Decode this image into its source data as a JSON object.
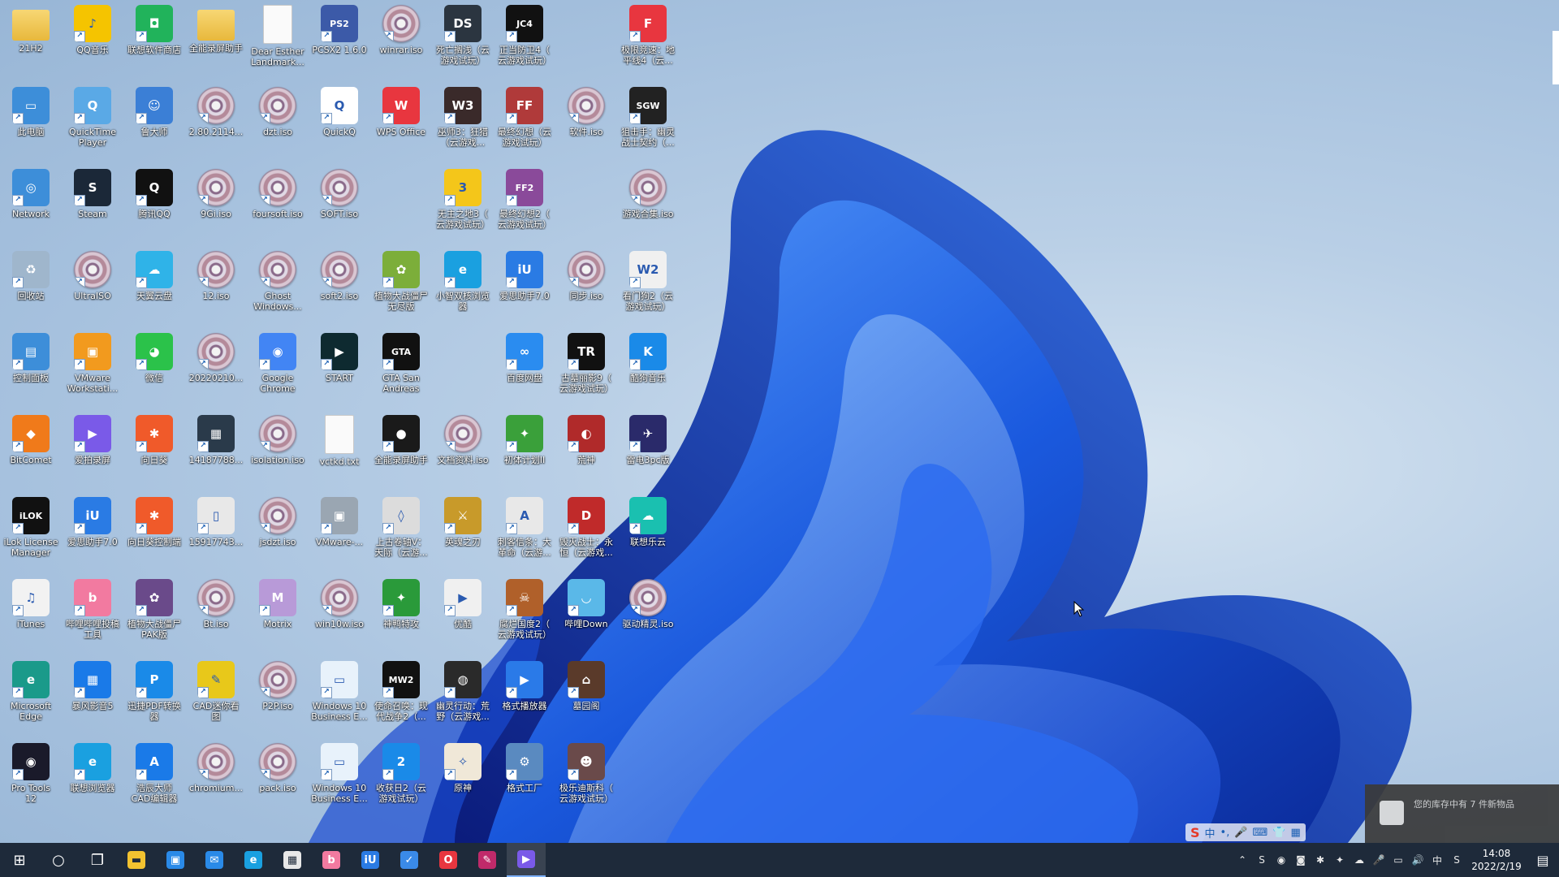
{
  "desktop": {
    "icons": [
      {
        "label": "21H2",
        "kind": "folder",
        "color": "#e9b94a",
        "glyph": "",
        "col": 0,
        "row": 0
      },
      {
        "label": "QQ音乐",
        "kind": "app",
        "color": "#f5c400",
        "glyph": "♪",
        "col": 1,
        "row": 0
      },
      {
        "label": "联想软件商店",
        "kind": "app",
        "color": "#21b35b",
        "glyph": "◘",
        "col": 2,
        "row": 0
      },
      {
        "label": "全能录屏助手",
        "kind": "folder",
        "color": "#e9b94a",
        "glyph": "",
        "col": 3,
        "row": 0
      },
      {
        "label": "Dear Esther\nLandmark...",
        "kind": "file",
        "color": "#fafafa",
        "glyph": "",
        "col": 4,
        "row": 0
      },
      {
        "label": "PCSX2 1.6.0",
        "kind": "app",
        "color": "#3c5aa8",
        "glyph": "PS2",
        "col": 5,
        "row": 0
      },
      {
        "label": "winrar.iso",
        "kind": "disc",
        "color": "",
        "glyph": "",
        "col": 6,
        "row": 0
      },
      {
        "label": "死亡搁浅（云\n游戏试玩）",
        "kind": "app",
        "color": "#2b3540",
        "glyph": "DS",
        "col": 7,
        "row": 0
      },
      {
        "label": "正当防卫4（\n云游戏试玩）",
        "kind": "app",
        "color": "#111111",
        "glyph": "JC4",
        "col": 8,
        "row": 0
      },
      {
        "label": "极限竞速：地\n平线4（云...",
        "kind": "app",
        "color": "#e8363f",
        "glyph": "F",
        "col": 10,
        "row": 0
      },
      {
        "label": "此电脑",
        "kind": "app",
        "color": "#3d8ed9",
        "glyph": "▭",
        "col": 0,
        "row": 1
      },
      {
        "label": "QuickTime\nPlayer",
        "kind": "app",
        "color": "#5aa9e6",
        "glyph": "Q",
        "col": 1,
        "row": 1
      },
      {
        "label": "鲁大师",
        "kind": "app",
        "color": "#3b7fd6",
        "glyph": "☺",
        "col": 2,
        "row": 1
      },
      {
        "label": "2.80.2114...",
        "kind": "disc",
        "color": "",
        "glyph": "",
        "col": 3,
        "row": 1
      },
      {
        "label": "dzt.iso",
        "kind": "disc",
        "color": "",
        "glyph": "",
        "col": 4,
        "row": 1
      },
      {
        "label": "QuickQ",
        "kind": "app",
        "color": "#ffffff",
        "glyph": "Q",
        "col": 5,
        "row": 1
      },
      {
        "label": "WPS Office",
        "kind": "app",
        "color": "#e8363f",
        "glyph": "W",
        "col": 6,
        "row": 1
      },
      {
        "label": "巫师3：狂猎\n（云游戏...",
        "kind": "app",
        "color": "#3a2a2a",
        "glyph": "W3",
        "col": 7,
        "row": 1
      },
      {
        "label": "最终幻想（云\n游戏试玩）",
        "kind": "app",
        "color": "#b03a3a",
        "glyph": "FF",
        "col": 8,
        "row": 1
      },
      {
        "label": "软件.iso",
        "kind": "disc",
        "color": "",
        "glyph": "",
        "col": 9,
        "row": 1
      },
      {
        "label": "狙击手：幽灵\n战士契约（...",
        "kind": "app",
        "color": "#222222",
        "glyph": "SGW",
        "col": 10,
        "row": 1
      },
      {
        "label": "Network",
        "kind": "app",
        "color": "#3d8ed9",
        "glyph": "◎",
        "col": 0,
        "row": 2
      },
      {
        "label": "Steam",
        "kind": "app",
        "color": "#1b2838",
        "glyph": "S",
        "col": 1,
        "row": 2
      },
      {
        "label": "腾讯QQ",
        "kind": "app",
        "color": "#111111",
        "glyph": "Q",
        "col": 2,
        "row": 2
      },
      {
        "label": "9Gi.iso",
        "kind": "disc",
        "color": "",
        "glyph": "",
        "col": 3,
        "row": 2
      },
      {
        "label": "foursoft.iso",
        "kind": "disc",
        "color": "",
        "glyph": "",
        "col": 4,
        "row": 2
      },
      {
        "label": "SOFT.iso",
        "kind": "disc",
        "color": "",
        "glyph": "",
        "col": 5,
        "row": 2
      },
      {
        "label": "无主之地3（\n云游戏试玩）",
        "kind": "app",
        "color": "#f4c61a",
        "glyph": "3",
        "col": 7,
        "row": 2
      },
      {
        "label": "最终幻想2（\n云游戏试玩）",
        "kind": "app",
        "color": "#8a4a9a",
        "glyph": "FF2",
        "col": 8,
        "row": 2
      },
      {
        "label": "游戏合集.iso",
        "kind": "disc",
        "color": "",
        "glyph": "",
        "col": 10,
        "row": 2
      },
      {
        "label": "回收站",
        "kind": "app",
        "color": "#9fb6cc",
        "glyph": "♻",
        "col": 0,
        "row": 3
      },
      {
        "label": "UltraISO",
        "kind": "disc",
        "color": "",
        "glyph": "",
        "col": 1,
        "row": 3
      },
      {
        "label": "天翼云盘",
        "kind": "app",
        "color": "#2fb3e8",
        "glyph": "☁",
        "col": 2,
        "row": 3
      },
      {
        "label": "12.iso",
        "kind": "disc",
        "color": "",
        "glyph": "",
        "col": 3,
        "row": 3
      },
      {
        "label": "Ghost\nWindows...",
        "kind": "disc",
        "color": "",
        "glyph": "",
        "col": 4,
        "row": 3
      },
      {
        "label": "soft2.iso",
        "kind": "disc",
        "color": "",
        "glyph": "",
        "col": 5,
        "row": 3
      },
      {
        "label": "植物大战僵尸\n无尽版",
        "kind": "app",
        "color": "#7cae3a",
        "glyph": "✿",
        "col": 6,
        "row": 3
      },
      {
        "label": "小智双核浏览\n器",
        "kind": "app",
        "color": "#1aa0e0",
        "glyph": "e",
        "col": 7,
        "row": 3
      },
      {
        "label": "爱思助手7.0",
        "kind": "app",
        "color": "#2a7be4",
        "glyph": "iU",
        "col": 8,
        "row": 3
      },
      {
        "label": "同步.iso",
        "kind": "disc",
        "color": "",
        "glyph": "",
        "col": 9,
        "row": 3
      },
      {
        "label": "看门狗2（云\n游戏试玩）",
        "kind": "app",
        "color": "#f0f0f0",
        "glyph": "W2",
        "col": 10,
        "row": 3
      },
      {
        "label": "控制面板",
        "kind": "app",
        "color": "#3d8ed9",
        "glyph": "▤",
        "col": 0,
        "row": 4
      },
      {
        "label": "VMware\nWorkstati...",
        "kind": "app",
        "color": "#f29a1e",
        "glyph": "▣",
        "col": 1,
        "row": 4
      },
      {
        "label": "微信",
        "kind": "app",
        "color": "#2bc24a",
        "glyph": "◕",
        "col": 2,
        "row": 4
      },
      {
        "label": "20220210...",
        "kind": "disc",
        "color": "",
        "glyph": "",
        "col": 3,
        "row": 4
      },
      {
        "label": "Google\nChrome",
        "kind": "app",
        "color": "#4285f4",
        "glyph": "◉",
        "col": 4,
        "row": 4
      },
      {
        "label": "START",
        "kind": "app",
        "color": "#0e2a30",
        "glyph": "▶",
        "col": 5,
        "row": 4
      },
      {
        "label": "GTA San\nAndreas",
        "kind": "app",
        "color": "#111111",
        "glyph": "GTA",
        "col": 6,
        "row": 4
      },
      {
        "label": "百度网盘",
        "kind": "app",
        "color": "#2a8cf0",
        "glyph": "∞",
        "col": 8,
        "row": 4
      },
      {
        "label": "古墓丽影9（\n云游戏试玩）",
        "kind": "app",
        "color": "#111111",
        "glyph": "TR",
        "col": 9,
        "row": 4
      },
      {
        "label": "酷狗音乐",
        "kind": "app",
        "color": "#1a8ae8",
        "glyph": "K",
        "col": 10,
        "row": 4
      },
      {
        "label": "BitComet",
        "kind": "app",
        "color": "#f07a1a",
        "glyph": "◆",
        "col": 0,
        "row": 5
      },
      {
        "label": "爱拍录屏",
        "kind": "app",
        "color": "#7a5ae8",
        "glyph": "▶",
        "col": 1,
        "row": 5
      },
      {
        "label": "向日葵",
        "kind": "app",
        "color": "#f05a2a",
        "glyph": "✱",
        "col": 2,
        "row": 5
      },
      {
        "label": "14187788...",
        "kind": "app",
        "color": "#2a3a4a",
        "glyph": "▦",
        "col": 3,
        "row": 5
      },
      {
        "label": "isolation.iso",
        "kind": "disc",
        "color": "",
        "glyph": "",
        "col": 4,
        "row": 5
      },
      {
        "label": "vctkd.txt",
        "kind": "file",
        "color": "#fafafa",
        "glyph": "",
        "col": 5,
        "row": 5
      },
      {
        "label": "全能录屏助手",
        "kind": "app",
        "color": "#1a1a1a",
        "glyph": "●",
        "col": 6,
        "row": 5
      },
      {
        "label": "文档资料.iso",
        "kind": "disc",
        "color": "",
        "glyph": "",
        "col": 7,
        "row": 5
      },
      {
        "label": "初体计划II",
        "kind": "app",
        "color": "#3aa03a",
        "glyph": "✦",
        "col": 8,
        "row": 5
      },
      {
        "label": "荒神",
        "kind": "app",
        "color": "#b02a2a",
        "glyph": "◐",
        "col": 9,
        "row": 5
      },
      {
        "label": "雷电3pc版",
        "kind": "app",
        "color": "#2a2a6a",
        "glyph": "✈",
        "col": 10,
        "row": 5
      },
      {
        "label": "iLok License\nManager",
        "kind": "app",
        "color": "#111111",
        "glyph": "iLOK",
        "col": 0,
        "row": 6
      },
      {
        "label": "爱思助手7.0",
        "kind": "app",
        "color": "#2a7be4",
        "glyph": "iU",
        "col": 1,
        "row": 6
      },
      {
        "label": "向日葵控制端",
        "kind": "app",
        "color": "#f05a2a",
        "glyph": "✱",
        "col": 2,
        "row": 6
      },
      {
        "label": "15917743...",
        "kind": "app",
        "color": "#e8e8e8",
        "glyph": "▯",
        "col": 3,
        "row": 6
      },
      {
        "label": "jsdzt.iso",
        "kind": "disc",
        "color": "",
        "glyph": "",
        "col": 4,
        "row": 6
      },
      {
        "label": "VMware-...",
        "kind": "app",
        "color": "#9aa6b2",
        "glyph": "▣",
        "col": 5,
        "row": 6
      },
      {
        "label": "上古卷轴V：\n天际（云游...",
        "kind": "app",
        "color": "#dcdcdc",
        "glyph": "◊",
        "col": 6,
        "row": 6
      },
      {
        "label": "英魂之刃",
        "kind": "app",
        "color": "#c89a2a",
        "glyph": "⚔",
        "col": 7,
        "row": 6
      },
      {
        "label": "刺客信条：大\n革命（云游...",
        "kind": "app",
        "color": "#e8e8e8",
        "glyph": "A",
        "col": 8,
        "row": 6
      },
      {
        "label": "毁灭战士：永\n恒（云游戏...",
        "kind": "app",
        "color": "#c02a2a",
        "glyph": "D",
        "col": 9,
        "row": 6
      },
      {
        "label": "联想乐云",
        "kind": "app",
        "color": "#1ac0b0",
        "glyph": "☁",
        "col": 10,
        "row": 6
      },
      {
        "label": "iTunes",
        "kind": "app",
        "color": "#f2f2f2",
        "glyph": "♫",
        "col": 0,
        "row": 7
      },
      {
        "label": "哔哩哔哩投稿\n工具",
        "kind": "app",
        "color": "#f27aa0",
        "glyph": "b",
        "col": 1,
        "row": 7
      },
      {
        "label": "植物大战僵尸\nPAK版",
        "kind": "app",
        "color": "#6a4a8a",
        "glyph": "✿",
        "col": 2,
        "row": 7
      },
      {
        "label": "Bt.iso",
        "kind": "disc",
        "color": "",
        "glyph": "",
        "col": 3,
        "row": 7
      },
      {
        "label": "Motrix",
        "kind": "app",
        "color": "#b89ad8",
        "glyph": "M",
        "col": 4,
        "row": 7
      },
      {
        "label": "win10w.iso",
        "kind": "disc",
        "color": "",
        "glyph": "",
        "col": 5,
        "row": 7
      },
      {
        "label": "神鸭特攻",
        "kind": "app",
        "color": "#2a9a3a",
        "glyph": "✦",
        "col": 6,
        "row": 7
      },
      {
        "label": "优酷",
        "kind": "app",
        "color": "#f0f0f0",
        "glyph": "▶",
        "col": 7,
        "row": 7
      },
      {
        "label": "腐烂国度2（\n云游戏试玩）",
        "kind": "app",
        "color": "#b0602a",
        "glyph": "☠",
        "col": 8,
        "row": 7
      },
      {
        "label": "哔哩Down",
        "kind": "app",
        "color": "#5ab8e8",
        "glyph": "◡",
        "col": 9,
        "row": 7
      },
      {
        "label": "驱动精灵.iso",
        "kind": "disc",
        "color": "",
        "glyph": "",
        "col": 10,
        "row": 7
      },
      {
        "label": "Microsoft\nEdge",
        "kind": "app",
        "color": "#1a9a8a",
        "glyph": "e",
        "col": 0,
        "row": 8
      },
      {
        "label": "暴风影音5",
        "kind": "app",
        "color": "#1a7ae8",
        "glyph": "▦",
        "col": 1,
        "row": 8
      },
      {
        "label": "迅捷PDF转换\n器",
        "kind": "app",
        "color": "#1a8ae8",
        "glyph": "P",
        "col": 2,
        "row": 8
      },
      {
        "label": "CAD迷你看\n图",
        "kind": "app",
        "color": "#e8c81a",
        "glyph": "✎",
        "col": 3,
        "row": 8
      },
      {
        "label": "P2P.iso",
        "kind": "disc",
        "color": "",
        "glyph": "",
        "col": 4,
        "row": 8
      },
      {
        "label": "Windows 10\nBusiness E...",
        "kind": "app",
        "color": "#e8f2fb",
        "glyph": "▭",
        "col": 5,
        "row": 8
      },
      {
        "label": "使命召唤：现\n代战争2（...",
        "kind": "app",
        "color": "#111111",
        "glyph": "MW2",
        "col": 6,
        "row": 8
      },
      {
        "label": "幽灵行动：荒\n野（云游戏...",
        "kind": "app",
        "color": "#2a2a2a",
        "glyph": "◍",
        "col": 7,
        "row": 8
      },
      {
        "label": "格式播放器",
        "kind": "app",
        "color": "#2a7ae8",
        "glyph": "▶",
        "col": 8,
        "row": 8
      },
      {
        "label": "墓园阁",
        "kind": "app",
        "color": "#5a3a2a",
        "glyph": "⌂",
        "col": 9,
        "row": 8
      },
      {
        "label": "Pro Tools\n12",
        "kind": "app",
        "color": "#1a1a2a",
        "glyph": "◉",
        "col": 0,
        "row": 9
      },
      {
        "label": "联想浏览器",
        "kind": "app",
        "color": "#1aa0e0",
        "glyph": "e",
        "col": 1,
        "row": 9
      },
      {
        "label": "浩辰大师\nCAD编辑器",
        "kind": "app",
        "color": "#1a7ae8",
        "glyph": "A",
        "col": 2,
        "row": 9
      },
      {
        "label": "chromium...",
        "kind": "disc",
        "color": "",
        "glyph": "",
        "col": 3,
        "row": 9
      },
      {
        "label": "pack.iso",
        "kind": "disc",
        "color": "",
        "glyph": "",
        "col": 4,
        "row": 9
      },
      {
        "label": "Windows 10\nBusiness E...",
        "kind": "app",
        "color": "#e8f2fb",
        "glyph": "▭",
        "col": 5,
        "row": 9
      },
      {
        "label": "收获日2（云\n游戏试玩）",
        "kind": "app",
        "color": "#1a8ae8",
        "glyph": "2",
        "col": 6,
        "row": 9
      },
      {
        "label": "原神",
        "kind": "app",
        "color": "#f0e8d8",
        "glyph": "✧",
        "col": 7,
        "row": 9
      },
      {
        "label": "格式工厂",
        "kind": "app",
        "color": "#5a8ac0",
        "glyph": "⚙",
        "col": 8,
        "row": 9
      },
      {
        "label": "极乐迪斯科（\n云游戏试玩）",
        "kind": "app",
        "color": "#6a4a4a",
        "glyph": "☻",
        "col": 9,
        "row": 9
      }
    ]
  },
  "notification": {
    "text": "您的库存中有 7 件新物品"
  },
  "ime": {
    "brand": "S",
    "items": [
      "中",
      "•,",
      "🎤",
      "⌨",
      "👕",
      "▦"
    ]
  },
  "taskbar": {
    "items": [
      {
        "name": "start-button",
        "glyph": "⊞",
        "color": "#ffffff"
      },
      {
        "name": "search-button",
        "glyph": "○",
        "color": "#ffffff"
      },
      {
        "name": "task-view-button",
        "glyph": "❐",
        "color": "#ffffff"
      },
      {
        "name": "taskbar-file-explorer",
        "glyph": "▬",
        "color": "#f2c230"
      },
      {
        "name": "taskbar-store",
        "glyph": "▣",
        "color": "#2a8ae8"
      },
      {
        "name": "taskbar-mail",
        "glyph": "✉",
        "color": "#2a8ae8"
      },
      {
        "name": "taskbar-edge",
        "glyph": "e",
        "color": "#1aa0e0"
      },
      {
        "name": "taskbar-app-store",
        "glyph": "▦",
        "color": "#e8e8e8"
      },
      {
        "name": "taskbar-bilibili",
        "glyph": "b",
        "color": "#f27aa0"
      },
      {
        "name": "taskbar-aisi",
        "glyph": "iU",
        "color": "#2a7be4"
      },
      {
        "name": "taskbar-vpn",
        "glyph": "✓",
        "color": "#3a8ae8"
      },
      {
        "name": "taskbar-office",
        "glyph": "O",
        "color": "#e8363f"
      },
      {
        "name": "taskbar-recorder",
        "glyph": "✎",
        "color": "#c02a6a"
      },
      {
        "name": "taskbar-aipai",
        "glyph": "▶",
        "color": "#7a5ae8"
      }
    ],
    "tray": [
      "⌃",
      "S",
      "◉",
      "◙",
      "✱",
      "✦",
      "☁",
      "🎤",
      "▭",
      "🔊",
      "中",
      "S"
    ],
    "time": "14:08",
    "date": "2022/2/19",
    "notify_glyph": "▤"
  }
}
